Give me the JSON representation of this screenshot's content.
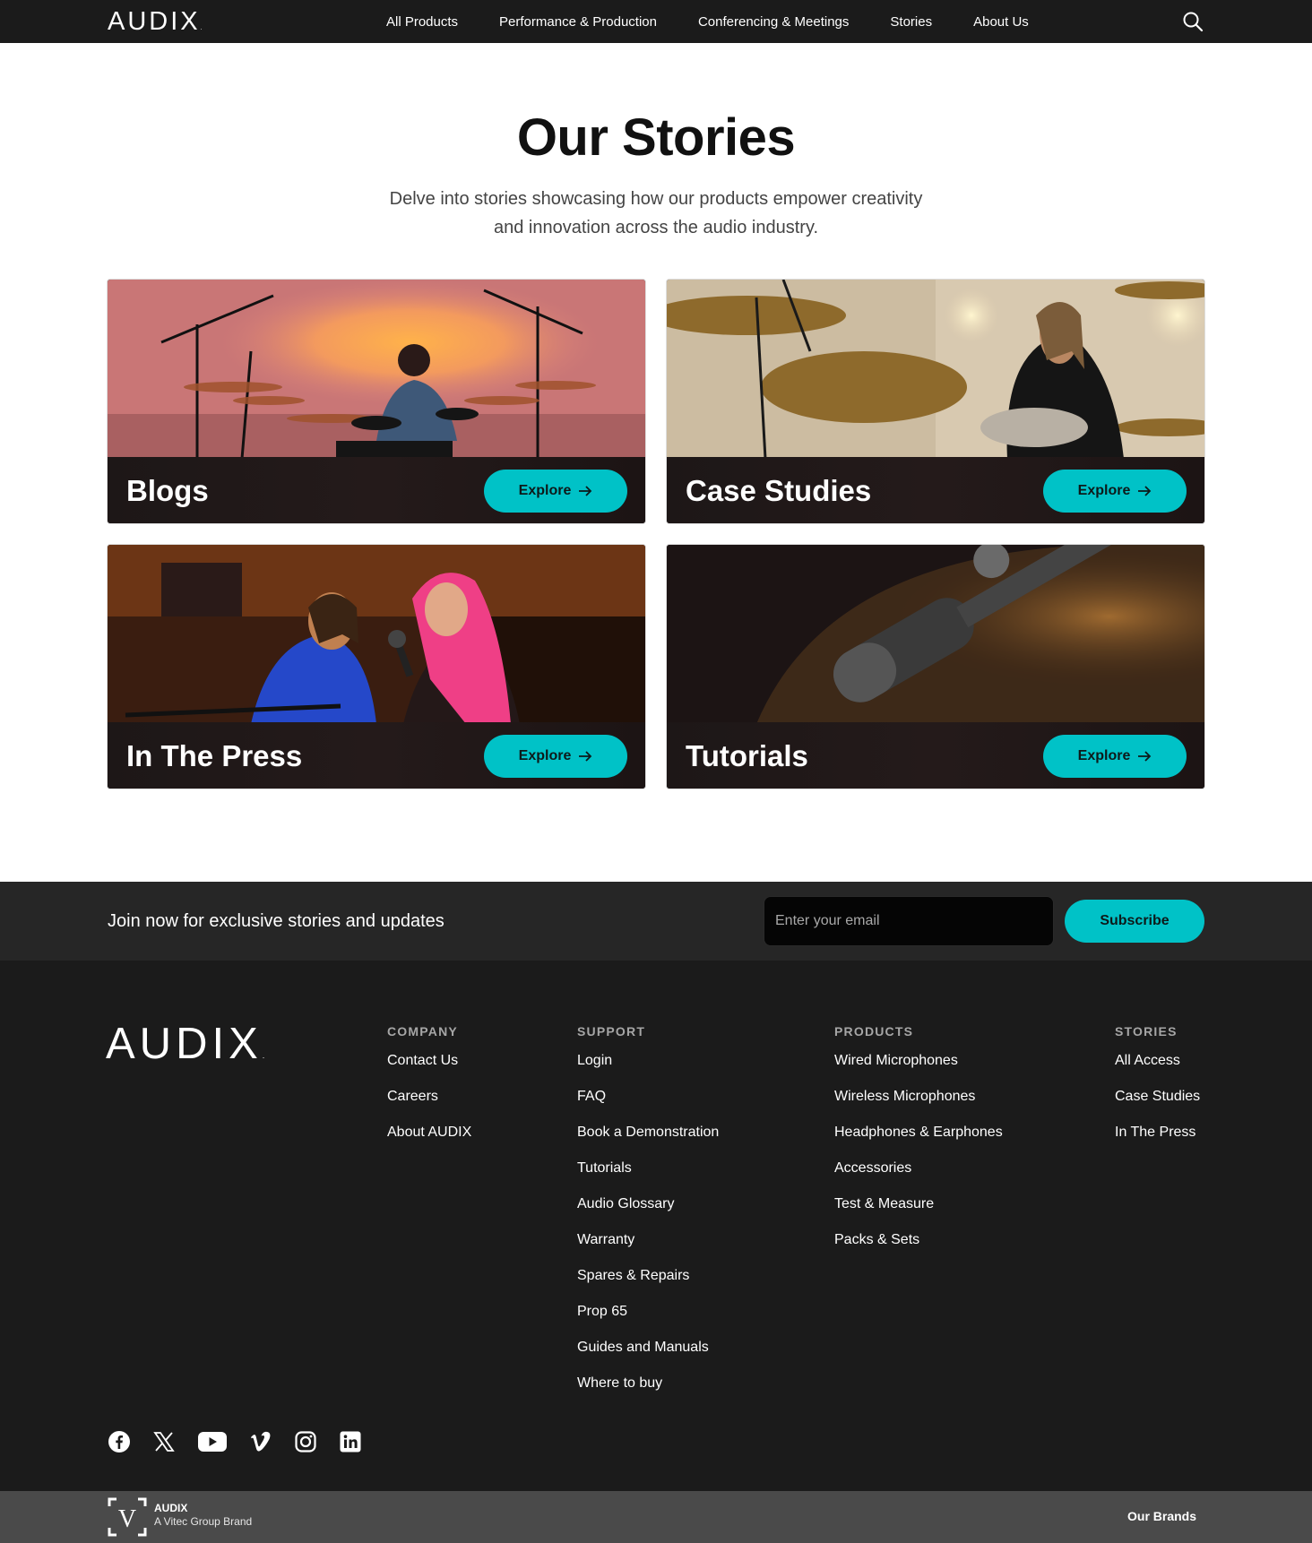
{
  "header": {
    "logo": "AUDIX",
    "nav": [
      "All Products",
      "Performance & Production",
      "Conferencing & Meetings",
      "Stories",
      "About Us"
    ],
    "search_icon": "search-icon"
  },
  "hero": {
    "title": "Our Stories",
    "subtitle": "Delve into stories showcasing how our products empower creativity and innovation across the audio industry."
  },
  "cards": [
    {
      "title": "Blogs",
      "button": "Explore"
    },
    {
      "title": "Case Studies",
      "button": "Explore"
    },
    {
      "title": "In The Press",
      "button": "Explore"
    },
    {
      "title": "Tutorials",
      "button": "Explore"
    }
  ],
  "newsletter": {
    "text": "Join now for exclusive stories and updates",
    "placeholder": "Enter your email",
    "button": "Subscribe"
  },
  "footer": {
    "logo": "AUDIX",
    "columns": [
      {
        "heading": "COMPANY",
        "links": [
          "Contact Us",
          "Careers",
          "About AUDIX"
        ]
      },
      {
        "heading": "SUPPORT",
        "links": [
          "Login",
          "FAQ",
          "Book a Demonstration",
          "Tutorials",
          "Audio Glossary",
          "Warranty",
          "Spares & Repairs",
          "Prop 65",
          "Guides and Manuals",
          "Where to buy"
        ]
      },
      {
        "heading": "PRODUCTS",
        "links": [
          "Wired Microphones",
          "Wireless Microphones",
          "Headphones & Earphones",
          "Accessories",
          "Test & Measure",
          "Packs & Sets"
        ]
      },
      {
        "heading": "STORIES",
        "links": [
          "All Access",
          "Case Studies",
          "In The Press"
        ]
      }
    ],
    "socials": [
      "facebook-icon",
      "x-icon",
      "youtube-icon",
      "vimeo-icon",
      "instagram-icon",
      "linkedin-icon"
    ]
  },
  "brandbar": {
    "brand": "AUDIX",
    "sub": "A Vitec Group Brand",
    "our_brands": "Our Brands"
  },
  "colors": {
    "accent": "#00c2c7",
    "dark": "#1b1b1b",
    "newsletter_bg": "#262626",
    "brandbar_bg": "#4a4a4a"
  }
}
